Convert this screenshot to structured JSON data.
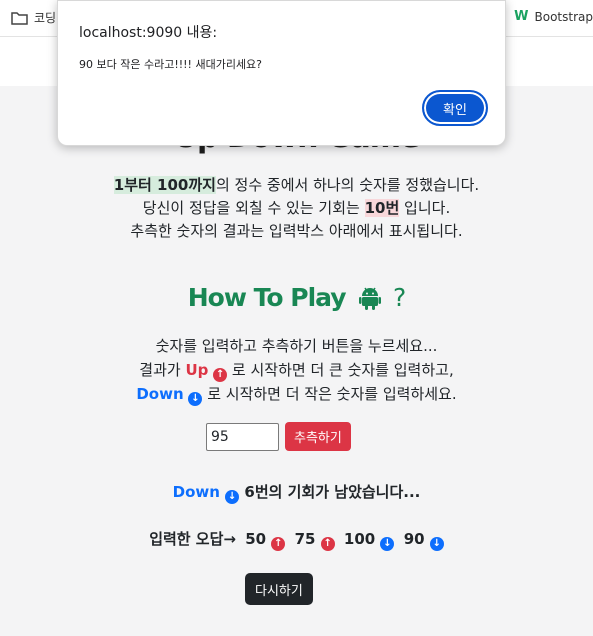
{
  "browser": {
    "bookmark_left": "코딩",
    "bookmark_right": "Bootstrap"
  },
  "page": {
    "title": "Up Down Game",
    "intro": {
      "line1_hl": "1부터 100까지",
      "line1_rest": "의 정수 중에서 하나의 숫자를 정했습니다.",
      "line2_pre": "당신이 정답을 외칠 수 있는 기회는 ",
      "line2_hl": "10번",
      "line2_post": " 입니다.",
      "line3": "추측한 숫자의 결과는 입력박스 아래에서 표시됩니다."
    },
    "howto": {
      "title": "How To Play",
      "q": "?"
    },
    "rules": {
      "line1": "숫자를 입력하고 추측하기 버튼을 누르세요...",
      "line2_pre": "결과가 ",
      "line2_up": "Up",
      "line2_post": " 로 시작하면 더 큰 숫자를 입력하고,",
      "line3_down": "Down",
      "line3_post": " 로 시작하면 더 작은 숫자를 입력하세요."
    },
    "guess_input_value": "95",
    "guess_button": "추측하기",
    "result": {
      "direction": "Down",
      "text": "6번의 기회가 남았습니다..."
    },
    "wrong": {
      "label": "입력한 오답→",
      "entries": [
        {
          "value": "50",
          "dir": "up"
        },
        {
          "value": "75",
          "dir": "up"
        },
        {
          "value": "100",
          "dir": "down"
        },
        {
          "value": "90",
          "dir": "down"
        }
      ]
    },
    "restart_button": "다시하기"
  },
  "dialog": {
    "title": "localhost:9090 내용:",
    "message": "90 보다 작은 수라고!!!! 새대가리세요?",
    "ok_label": "확인"
  },
  "colors": {
    "up": "#dc3545",
    "down": "#0d6efd",
    "green": "#198754",
    "ok_button": "#0b57d0"
  }
}
